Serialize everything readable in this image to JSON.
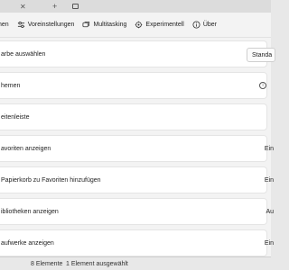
{
  "background": {
    "status_count": "8 Elemente",
    "status_selected": "1 Element ausgewählt"
  },
  "nav": {
    "items": [
      {
        "label": "hen",
        "icon": "none"
      },
      {
        "label": "Voreinstellungen",
        "icon": "sliders-icon"
      },
      {
        "label": "Multitasking",
        "icon": "multitasking-icon"
      },
      {
        "label": "Experimentell",
        "icon": "beaker-icon"
      },
      {
        "label": "Über",
        "icon": "info-icon"
      }
    ]
  },
  "settings": {
    "color_label": "arbe auswählen",
    "color_value": "Standa",
    "themes_label": "hemen",
    "sidebar_title": "eitenleiste",
    "rows": [
      {
        "label": "avoriten anzeigen",
        "value": "Ein"
      },
      {
        "label": "Papierkorb zu Favoriten hinzufügen",
        "value": "Ein"
      },
      {
        "label": "ibliotheken anzeigen",
        "value": "Au"
      },
      {
        "label": "aufwerke anzeigen",
        "value": "Ein"
      }
    ]
  },
  "colors": {
    "dialog_bg": "#f3f3f3",
    "card_bg": "#ffffff",
    "text": "#1f1f1f"
  }
}
